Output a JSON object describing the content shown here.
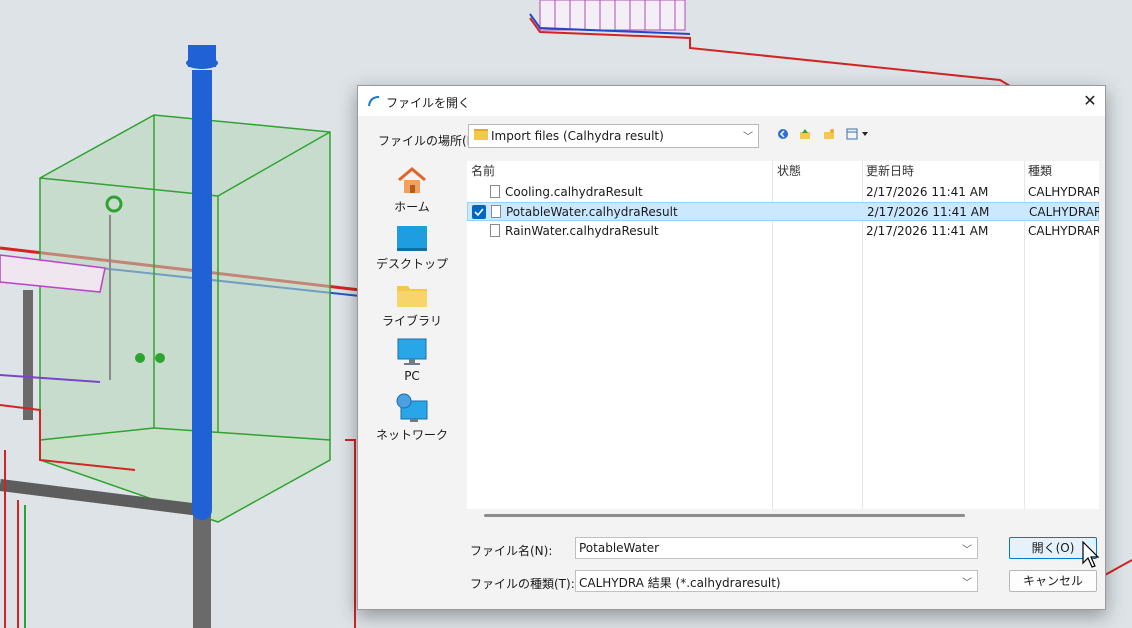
{
  "dialog": {
    "title": "ファイルを開く",
    "location_label": "ファイルの場所(I):",
    "location_value": "Import files (Calhydra result)",
    "toolbar_icons": [
      "back-icon",
      "up-folder-icon",
      "new-folder-icon",
      "view-menu-icon"
    ],
    "sidebar": [
      {
        "label": "ホーム",
        "icon": "home-icon"
      },
      {
        "label": "デスクトップ",
        "icon": "desktop-icon"
      },
      {
        "label": "ライブラリ",
        "icon": "library-icon"
      },
      {
        "label": "PC",
        "icon": "pc-icon"
      },
      {
        "label": "ネットワーク",
        "icon": "network-icon"
      }
    ],
    "columns": [
      "名前",
      "状態",
      "更新日時",
      "種類"
    ],
    "files": [
      {
        "name": "Cooling.calhydraResult",
        "status": "",
        "modified": "2/17/2026 11:41 AM",
        "type": "CALHYDRARI",
        "selected": false
      },
      {
        "name": "PotableWater.calhydraResult",
        "status": "",
        "modified": "2/17/2026 11:41 AM",
        "type": "CALHYDRARI",
        "selected": true
      },
      {
        "name": "RainWater.calhydraResult",
        "status": "",
        "modified": "2/17/2026 11:41 AM",
        "type": "CALHYDRARI",
        "selected": false
      }
    ],
    "filename_label": "ファイル名(N):",
    "filename_value": "PotableWater",
    "filetype_label": "ファイルの種類(T):",
    "filetype_value": "CALHYDRA 結果 (*.calhydraresult)",
    "open_button": "開く(O)",
    "cancel_button": "キャンセル",
    "colors": {
      "accent": "#0078d4",
      "selection": "#cce8ff",
      "checkbox": "#0067c0"
    }
  }
}
